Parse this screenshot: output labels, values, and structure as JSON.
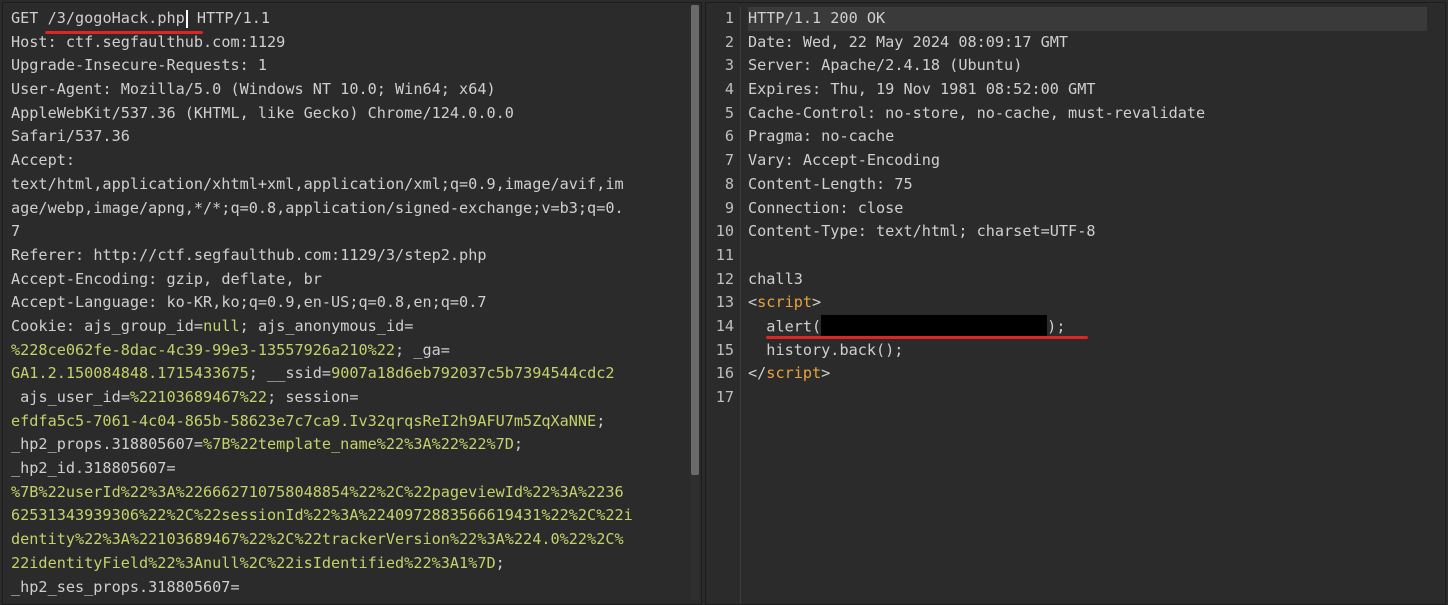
{
  "request": {
    "request_line": {
      "method": "GET",
      "path": "/3/gogoHack.php",
      "version": "HTTP/1.1"
    },
    "headers": [
      {
        "name": "Host",
        "value": "ctf.segfaulthub.com:1129"
      },
      {
        "name": "Upgrade-Insecure-Requests",
        "value": "1"
      },
      {
        "name": "User-Agent",
        "value": "Mozilla/5.0 (Windows NT 10.0; Win64; x64)"
      },
      {
        "name": "",
        "value": "AppleWebKit/537.36 (KHTML, like Gecko) Chrome/124.0.0.0"
      },
      {
        "name": "",
        "value": "Safari/537.36"
      },
      {
        "name": "Accept",
        "value": ""
      },
      {
        "name": "",
        "value": "text/html,application/xhtml+xml,application/xml;q=0.9,image/avif,im"
      },
      {
        "name": "",
        "value": "age/webp,image/apng,*/*;q=0.8,application/signed-exchange;v=b3;q=0."
      },
      {
        "name": "",
        "value": "7"
      },
      {
        "name": "Referer",
        "value": "http://ctf.segfaulthub.com:1129/3/step2.php"
      },
      {
        "name": "Accept-Encoding",
        "value": "gzip, deflate, br"
      },
      {
        "name": "Accept-Language",
        "value": "ko-KR,ko;q=0.9,en-US;q=0.8,en;q=0.7"
      }
    ],
    "cookie_label": "Cookie",
    "cookie_lines": [
      {
        "k": "ajs_group_id",
        "v": "null",
        "k2": "ajs_anonymous_id",
        "v2": ""
      },
      {
        "k": "",
        "v": "%228ce062fe-8dac-4c39-99e3-13557926a210%22",
        "k2": "_ga",
        "v2": ""
      },
      {
        "k": "",
        "v": "GA1.2.150084848.1715433675",
        "k2": "__ssid",
        "v2": "9007a18d6eb792037c5b7394544cdc2"
      },
      {
        "k": "ajs_user_id",
        "v": "%22103689467%22",
        "k2": "session",
        "v2": ""
      },
      {
        "k": "",
        "v": "efdfa5c5-7061-4c04-865b-58623e7c7ca9.Iv32qrqsReI2h9AFU7m5ZqXaNNE",
        "k2": "",
        "v2": ""
      },
      {
        "k": "_hp2_props.318805607",
        "v": "%7B%22template_name%22%3A%22%22%7D",
        "k2": "",
        "v2": ""
      },
      {
        "k": "_hp2_id.318805607",
        "v": "",
        "k2": "",
        "v2": ""
      },
      {
        "k": "",
        "v": "%7B%22userId%22%3A%226662710758048854%22%2C%22pageviewId%22%3A%2236",
        "k2": "",
        "v2": ""
      },
      {
        "k": "",
        "v": "62531343939306%22%2C%22sessionId%22%3A%2240972883566619431%22%2C%22i",
        "k2": "",
        "v2": ""
      },
      {
        "k": "",
        "v": "dentity%22%3A%22103689467%22%2C%22trackerVersion%22%3A%224.0%22%2C%",
        "k2": "",
        "v2": ""
      },
      {
        "k": "",
        "v": "22identityField%22%3Anull%2C%22isIdentified%22%3A1%7D",
        "k2": "",
        "v2": ""
      },
      {
        "k": "_hp2_ses_props.318805607",
        "v": "",
        "k2": "",
        "v2": ""
      }
    ]
  },
  "response": {
    "line_numbers": [
      "1",
      "2",
      "3",
      "4",
      "5",
      "6",
      "7",
      "8",
      "9",
      "10",
      "11",
      "12",
      "13",
      "14",
      "15",
      "16",
      "17"
    ],
    "status_line": "HTTP/1.1 200 OK",
    "headers": [
      {
        "name": "Date",
        "value": "Wed, 22 May 2024 08:09:17 GMT"
      },
      {
        "name": "Server",
        "value": "Apache/2.4.18 (Ubuntu)"
      },
      {
        "name": "Expires",
        "value": "Thu, 19 Nov 1981 08:52:00 GMT"
      },
      {
        "name": "Cache-Control",
        "value": "no-store, no-cache, must-revalidate"
      },
      {
        "name": "Pragma",
        "value": "no-cache"
      },
      {
        "name": "Vary",
        "value": "Accept-Encoding"
      },
      {
        "name": "Content-Length",
        "value": "75"
      },
      {
        "name": "Connection",
        "value": "close"
      },
      {
        "name": "Content-Type",
        "value": "text/html; charset=UTF-8"
      }
    ],
    "body": {
      "title": "chall3",
      "script_tag": "script",
      "alert_fn": "alert(",
      "alert_end": ");",
      "history": "history.back();"
    }
  },
  "colors": {
    "background": "#2b2b2b",
    "cookie_value": "#c5d16b",
    "tag": "#e8a33d",
    "annotation": "#e02424"
  }
}
